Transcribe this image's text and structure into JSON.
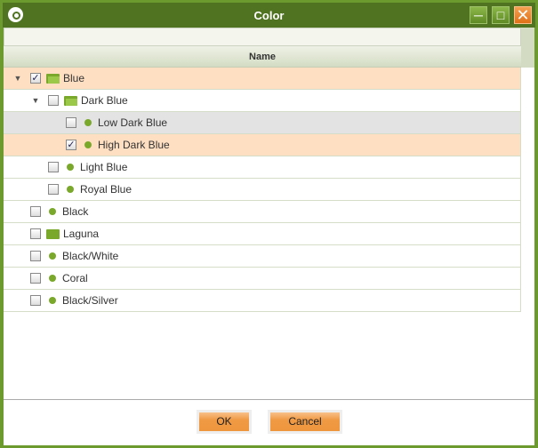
{
  "window": {
    "title": "Color",
    "minimize": "─",
    "maximize": "□",
    "close": "✕"
  },
  "grid": {
    "column_name": "Name",
    "filter_value": ""
  },
  "rows": [
    {
      "label": "Blue",
      "level": 0,
      "expanded": true,
      "checked": true,
      "icon": "folder-open-icon",
      "state": "selected"
    },
    {
      "label": "Dark Blue",
      "level": 1,
      "expanded": true,
      "checked": false,
      "icon": "folder-open-icon"
    },
    {
      "label": "Low Dark Blue",
      "level": 2,
      "checked": false,
      "icon": "dot-icon",
      "state": "hover"
    },
    {
      "label": "High Dark Blue",
      "level": 2,
      "checked": true,
      "icon": "dot-icon",
      "state": "selected"
    },
    {
      "label": "Light Blue",
      "level": 1,
      "checked": false,
      "icon": "dot-icon"
    },
    {
      "label": "Royal Blue",
      "level": 1,
      "checked": false,
      "icon": "dot-icon"
    },
    {
      "label": "Black",
      "level": 0,
      "checked": false,
      "icon": "dot-icon"
    },
    {
      "label": "Laguna",
      "level": 0,
      "checked": false,
      "icon": "folder-icon"
    },
    {
      "label": "Black/White",
      "level": 0,
      "checked": false,
      "icon": "dot-icon"
    },
    {
      "label": "Coral",
      "level": 0,
      "checked": false,
      "icon": "dot-icon"
    },
    {
      "label": "Black/Silver",
      "level": 0,
      "checked": false,
      "icon": "dot-icon"
    }
  ],
  "buttons": {
    "ok": "OK",
    "cancel": "Cancel"
  }
}
